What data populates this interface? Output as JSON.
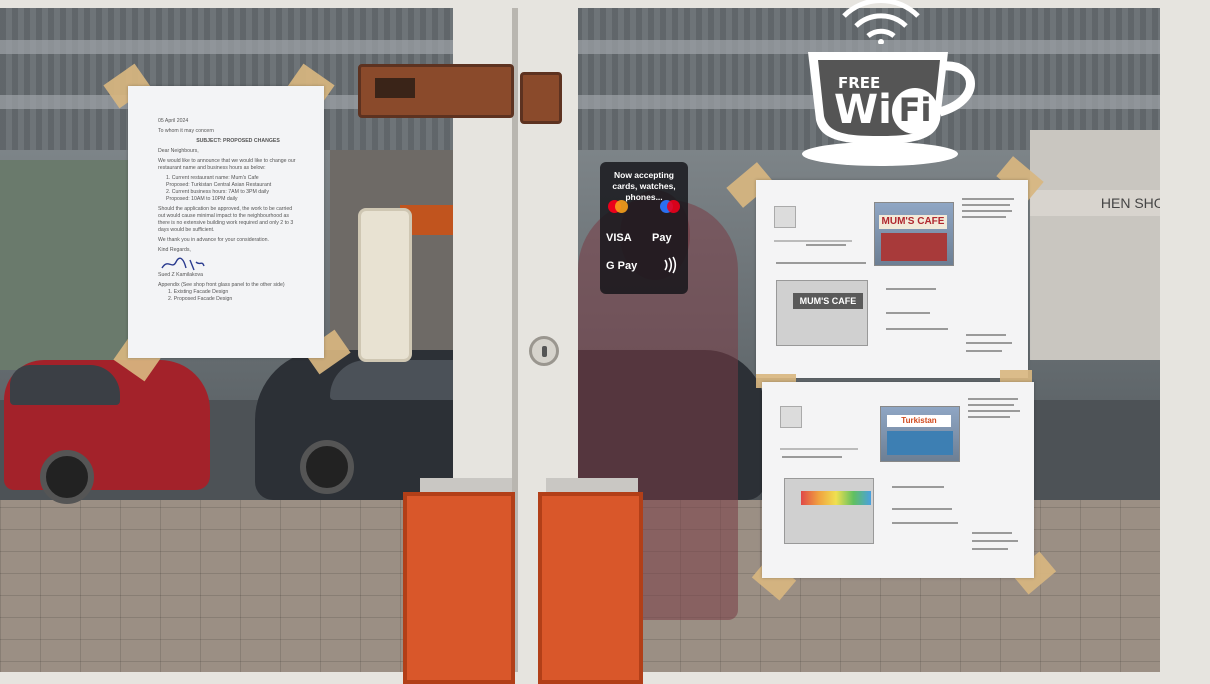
{
  "notice": {
    "date": "05 April 2024",
    "salutation_to": "To whom it may concern",
    "subject": "SUBJECT: PROPOSED CHANGES",
    "greeting": "Dear Neighbours,",
    "body_lines": [
      "We would like to announce that we would like to change our",
      "restaurant name and business hours as below:",
      "1. Current restaurant name: Mum's Cafe",
      "   Proposed: Turkistan Central Asian Restaurant",
      "2. Current business hours: 7AM to 3PM daily",
      "   Proposed: 10AM to 10PM daily",
      "Should the application be approved, the work to be carried",
      "out would cause minimal impact to the neighbourhood as",
      "there is no extensive building work required and only 2 to 3",
      "days would be sufficient.",
      "We thank you in advance for your consideration.",
      "Kind Regards,",
      "Sued Z Kamilakova",
      "Appendix (See shop front glass panel to the other side)",
      "1. Existing Facade Design",
      "2. Proposed Facade Design"
    ]
  },
  "wifi_sticker": {
    "line1": "FREE",
    "line2": "Wi",
    "line3": "Fi"
  },
  "card_sticker": {
    "headline": "Now accepting cards, watches, phones...",
    "methods": [
      "VISA",
      "Pay",
      "G Pay"
    ]
  },
  "drawings": {
    "existing_sign": "MUM'S CAFE",
    "proposed_sign": "Turkistan"
  },
  "reflection": {
    "shop_sign": "HEN SHOP"
  },
  "colors": {
    "door_frame": "#e6e4df",
    "kickplate": "#d9572a",
    "hinge": "#8a4a2b",
    "tape": "#d8b680"
  }
}
